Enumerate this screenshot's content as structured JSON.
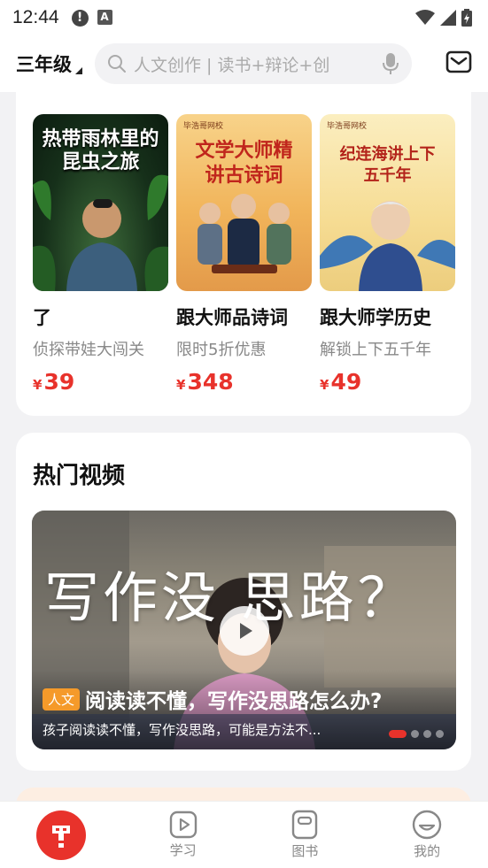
{
  "status_bar": {
    "time": "12:44",
    "alert_glyph": "!",
    "a_glyph": "A",
    "icons": [
      "alert-icon",
      "text-a-icon",
      "wifi-icon",
      "signal-icon",
      "battery-icon"
    ]
  },
  "header": {
    "grade_label": "三年级",
    "search_placeholder": "人文创作 | 读书+辩论+创",
    "icons": [
      "search-icon",
      "microphone-icon",
      "mail-icon"
    ]
  },
  "courses": [
    {
      "cover_title": "热带雨林里的昆虫之旅",
      "title": "了",
      "subtitle": "侦探带娃大闯关",
      "price_symbol": "¥",
      "price": "39"
    },
    {
      "cover_title": "文学大师精讲古诗词",
      "cover_badge": "毕浩哥网校",
      "title": "跟大师品诗词",
      "subtitle": "限时5折优惠",
      "price_symbol": "¥",
      "price": "348"
    },
    {
      "cover_title": "纪连海讲上下五千年",
      "cover_badge": "毕浩哥网校",
      "title": "跟大师学历史",
      "subtitle": "解锁上下五千年",
      "price_symbol": "¥",
      "price": "49"
    }
  ],
  "hot_videos": {
    "section_title": "热门视频",
    "video": {
      "overlay_text": "写作没 思路？",
      "tag": "人文",
      "title": "阅读读不懂，写作没思路怎么办?",
      "description": "孩子阅读读不懂，写作没思路，可能是方法不...",
      "slide_count": 4,
      "active_slide": 1
    }
  },
  "tab_bar": {
    "tabs": [
      {
        "label": "",
        "icon": "home-logo-icon",
        "active": true
      },
      {
        "label": "学习",
        "icon": "play-square-icon"
      },
      {
        "label": "图书",
        "icon": "book-icon"
      },
      {
        "label": "我的",
        "icon": "smile-face-icon"
      }
    ]
  },
  "colors": {
    "accent": "#e8322b",
    "tag": "#f59a2a",
    "background": "#f2f2f4"
  }
}
